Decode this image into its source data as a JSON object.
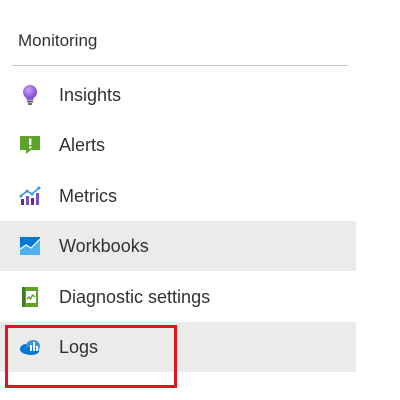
{
  "section": {
    "title": "Monitoring"
  },
  "items": [
    {
      "label": "Insights",
      "icon": "lightbulb-icon"
    },
    {
      "label": "Alerts",
      "icon": "alert-icon"
    },
    {
      "label": "Metrics",
      "icon": "metrics-icon"
    },
    {
      "label": "Workbooks",
      "icon": "workbooks-icon"
    },
    {
      "label": "Diagnostic settings",
      "icon": "diagnostic-settings-icon"
    },
    {
      "label": "Logs",
      "icon": "logs-icon"
    }
  ],
  "colors": {
    "highlight_border": "#e81123",
    "hover_background": "#edebe9",
    "text": "#323130"
  }
}
